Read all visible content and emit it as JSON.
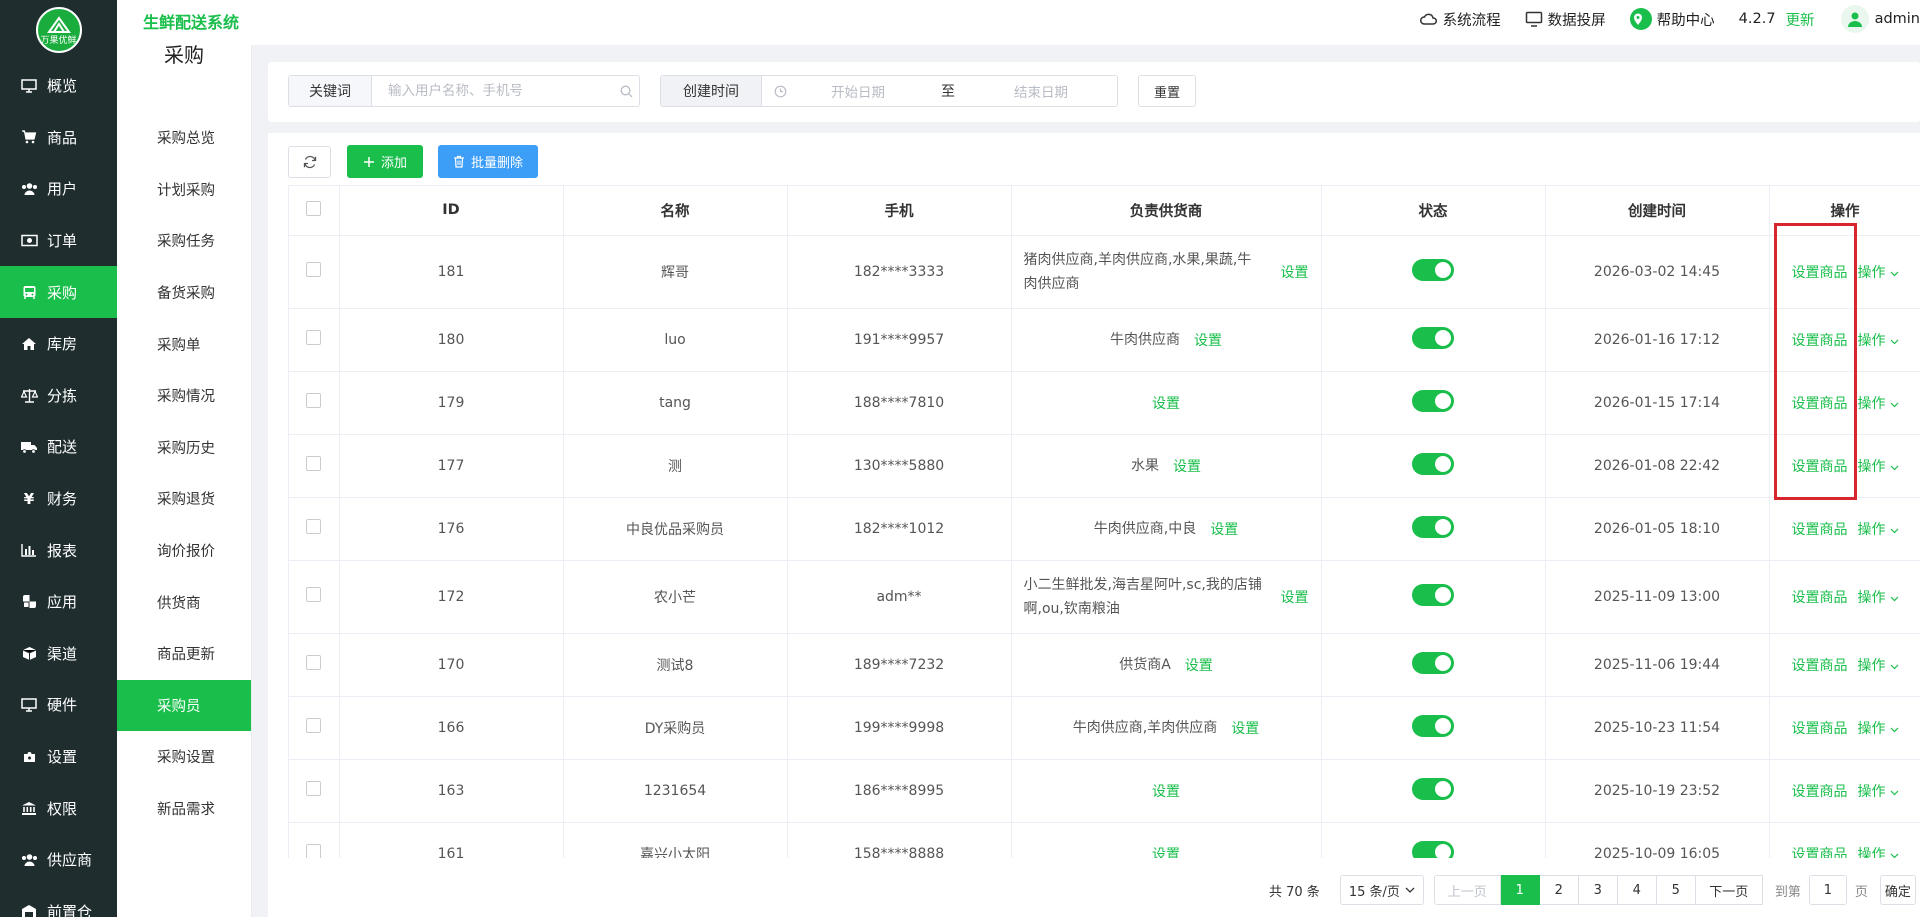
{
  "brand": {
    "logo_text": "万果优鲜",
    "app_title": "生鲜配送系统"
  },
  "header": {
    "system_flow": "系统流程",
    "data_screen": "数据投屏",
    "help_center": "帮助中心",
    "version": "4.2.7",
    "update": "更新",
    "user": "admin"
  },
  "sidebar": {
    "items": [
      {
        "label": "概览",
        "icon": "monitor-icon"
      },
      {
        "label": "商品",
        "icon": "cart-icon"
      },
      {
        "label": "用户",
        "icon": "users-icon"
      },
      {
        "label": "订单",
        "icon": "money-icon"
      },
      {
        "label": "采购",
        "icon": "bus-icon",
        "active": true
      },
      {
        "label": "库房",
        "icon": "home-icon"
      },
      {
        "label": "分拣",
        "icon": "scale-icon"
      },
      {
        "label": "配送",
        "icon": "truck-icon"
      },
      {
        "label": "财务",
        "icon": "yen-icon"
      },
      {
        "label": "报表",
        "icon": "chart-icon"
      },
      {
        "label": "应用",
        "icon": "apps-icon"
      },
      {
        "label": "渠道",
        "icon": "cube-icon"
      },
      {
        "label": "硬件",
        "icon": "desktop-icon"
      },
      {
        "label": "设置",
        "icon": "puzzle-icon"
      },
      {
        "label": "权限",
        "icon": "bank-icon"
      },
      {
        "label": "供应商",
        "icon": "suppliers-icon"
      },
      {
        "label": "前置仓",
        "icon": "warehouse-icon"
      }
    ]
  },
  "submenu": {
    "title": "采购",
    "items": [
      {
        "label": "采购总览"
      },
      {
        "label": "计划采购"
      },
      {
        "label": "采购任务"
      },
      {
        "label": "备货采购"
      },
      {
        "label": "采购单"
      },
      {
        "label": "采购情况"
      },
      {
        "label": "采购历史"
      },
      {
        "label": "采购退货"
      },
      {
        "label": "询价报价"
      },
      {
        "label": "供货商"
      },
      {
        "label": "商品更新"
      },
      {
        "label": "采购员",
        "active": true
      },
      {
        "label": "采购设置"
      },
      {
        "label": "新品需求"
      }
    ]
  },
  "search": {
    "keyword_label": "关键词",
    "keyword_placeholder": "输入用户名称、手机号",
    "date_label": "创建时间",
    "start_placeholder": "开始日期",
    "separator": "至",
    "end_placeholder": "结束日期",
    "reset": "重置"
  },
  "toolbar": {
    "add": "添加",
    "bulk_delete": "批量删除"
  },
  "table": {
    "columns": [
      "ID",
      "名称",
      "手机",
      "负责供货商",
      "状态",
      "创建时间",
      "操作"
    ],
    "set_label": "设置",
    "goods_label": "设置商品",
    "op_label": "操作",
    "rows": [
      {
        "id": "181",
        "name": "辉哥",
        "phone": "182****3333",
        "suppliers": "猪肉供应商,羊肉供应商,水果,果蔬,牛肉供应商",
        "status": true,
        "created": "2026-03-02 14:45"
      },
      {
        "id": "180",
        "name": "luo",
        "phone": "191****9957",
        "suppliers": "牛肉供应商",
        "status": true,
        "created": "2026-01-16 17:12"
      },
      {
        "id": "179",
        "name": "tang",
        "phone": "188****7810",
        "suppliers": "",
        "status": true,
        "created": "2026-01-15 17:14"
      },
      {
        "id": "177",
        "name": "测",
        "phone": "130****5880",
        "suppliers": "水果",
        "status": true,
        "created": "2026-01-08 22:42"
      },
      {
        "id": "176",
        "name": "中良优品采购员",
        "phone": "182****1012",
        "suppliers": "牛肉供应商,中良",
        "status": true,
        "created": "2026-01-05 18:10"
      },
      {
        "id": "172",
        "name": "农小芒",
        "phone": "adm**",
        "suppliers": "小二生鲜批发,海吉星阿叶,sc,我的店铺啊,ou,钦南粮油",
        "status": true,
        "created": "2025-11-09 13:00"
      },
      {
        "id": "170",
        "name": "测试8",
        "phone": "189****7232",
        "suppliers": "供货商A",
        "status": true,
        "created": "2025-11-06 19:44"
      },
      {
        "id": "166",
        "name": "DY采购员",
        "phone": "199****9998",
        "suppliers": "牛肉供应商,羊肉供应商",
        "status": true,
        "created": "2025-10-23 11:54"
      },
      {
        "id": "163",
        "name": "1231654",
        "phone": "186****8995",
        "suppliers": "",
        "status": true,
        "created": "2025-10-19 23:52"
      },
      {
        "id": "161",
        "name": "嘉兴小太阳",
        "phone": "158****8888",
        "suppliers": "",
        "status": true,
        "created": "2025-10-09 16:05"
      }
    ]
  },
  "pagination": {
    "total": "共 70 条",
    "page_size": "15 条/页",
    "prev": "上一页",
    "pages": [
      "1",
      "2",
      "3",
      "4",
      "5"
    ],
    "current": "1",
    "next": "下一页",
    "goto": "到第",
    "goto_value": "1",
    "page_unit": "页",
    "confirm": "确定"
  },
  "colors": {
    "brand_green": "#19be4b",
    "sidebar_bg": "#1f2d2f",
    "bulk_blue": "#3d9ef7",
    "highlight_red": "#d7262e"
  }
}
